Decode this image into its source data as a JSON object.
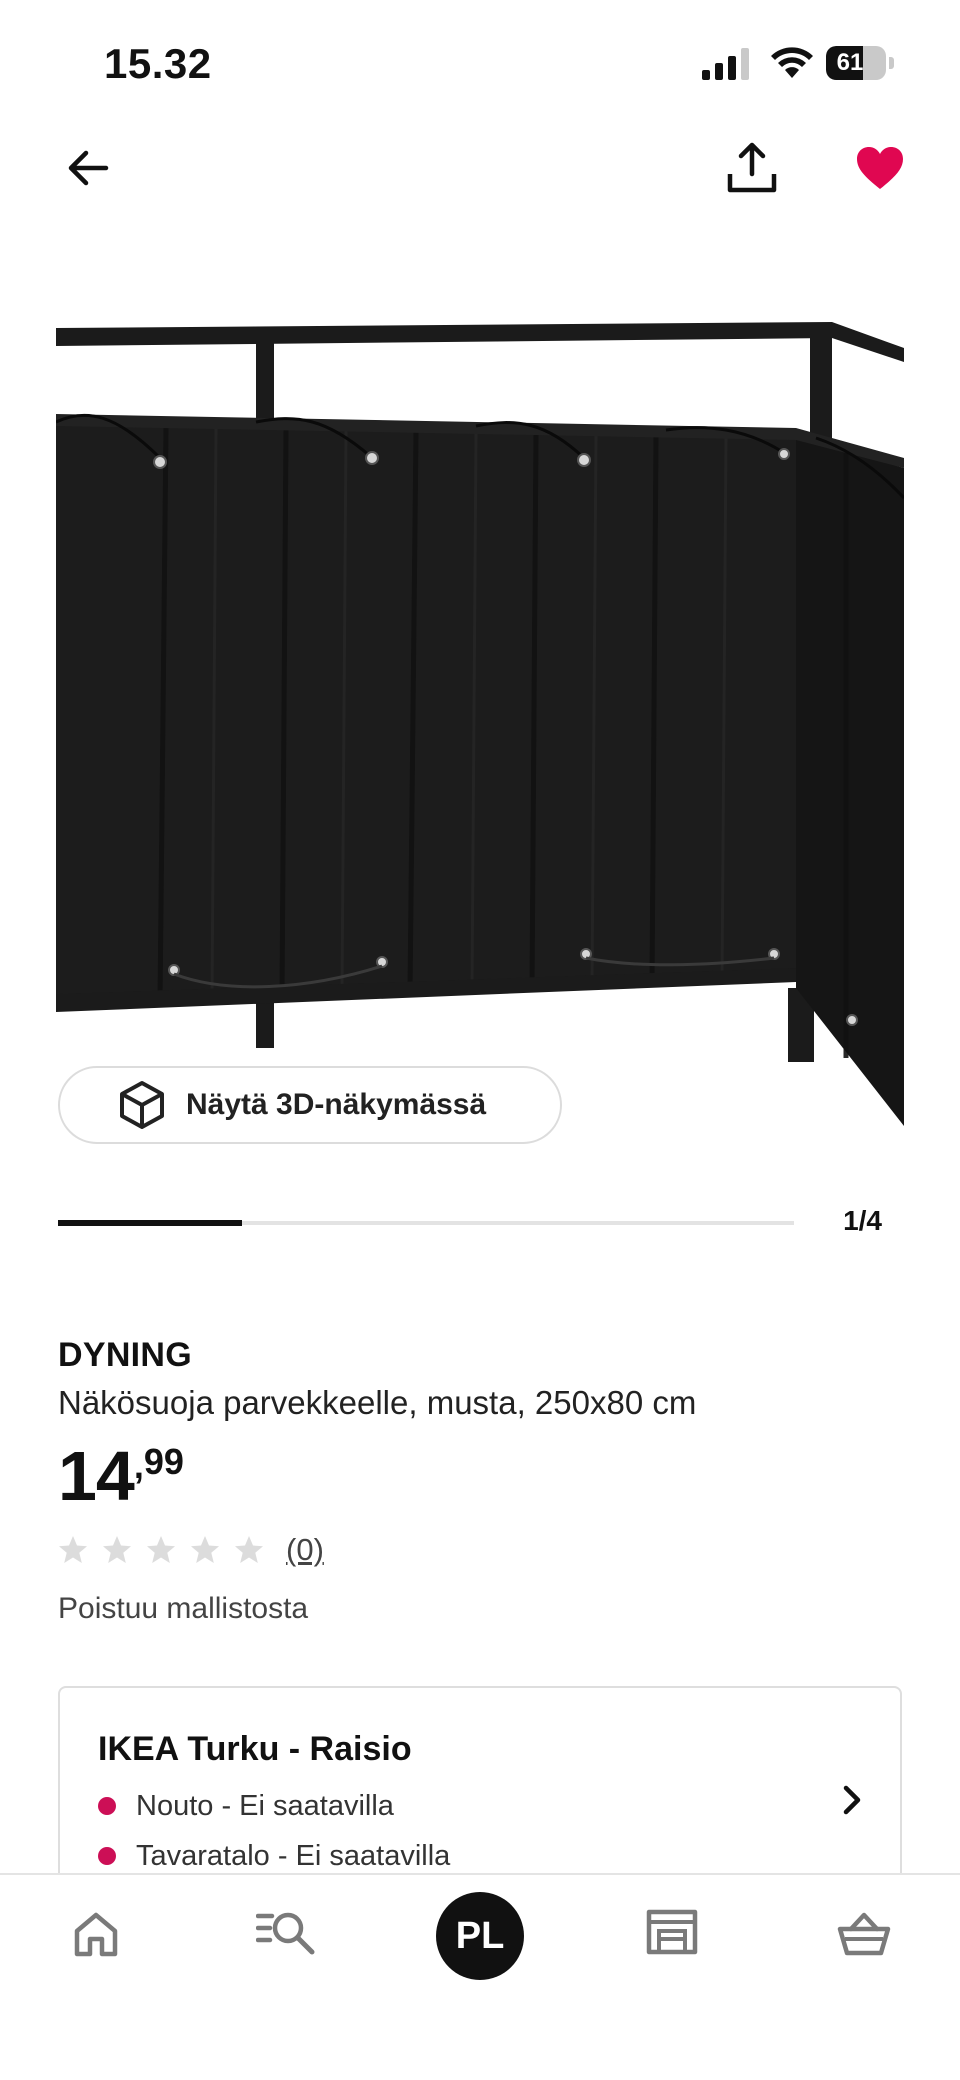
{
  "status_bar": {
    "time": "15.32",
    "battery": "61",
    "battery_level": 0.61
  },
  "top_nav": {
    "back_icon": "arrow-left-icon",
    "share_icon": "share-icon",
    "favorite_icon": "heart-icon",
    "favorite_active": true,
    "favorite_color": "#e00751"
  },
  "gallery": {
    "view_3d_label": "Näytä 3D-näkymässä",
    "cube_icon": "cube-3d-icon",
    "pager": "1/4",
    "progress": 0.25
  },
  "product": {
    "brand": "DYNING",
    "description": "Näkösuoja parvekkeelle, musta, 250x80 cm",
    "price_integer": "14",
    "price_comma": ",",
    "price_decimals": "99",
    "rating_stars": 0,
    "rating_max": 5,
    "rating_count": "(0)",
    "status": "Poistuu mallistosta"
  },
  "store": {
    "name": "IKEA Turku - Raisio",
    "availability": [
      {
        "label": "Nouto - Ei saatavilla",
        "status_color": "#cc0f56"
      },
      {
        "label": "Tavaratalo - Ei saatavilla",
        "status_color": "#cc0f56"
      }
    ],
    "chevron_icon": "chevron-right-icon"
  },
  "tab_bar": {
    "items": [
      "home-icon",
      "search-list-icon",
      "profile-avatar",
      "store-icon",
      "basket-icon"
    ],
    "avatar_initials": "PL"
  }
}
